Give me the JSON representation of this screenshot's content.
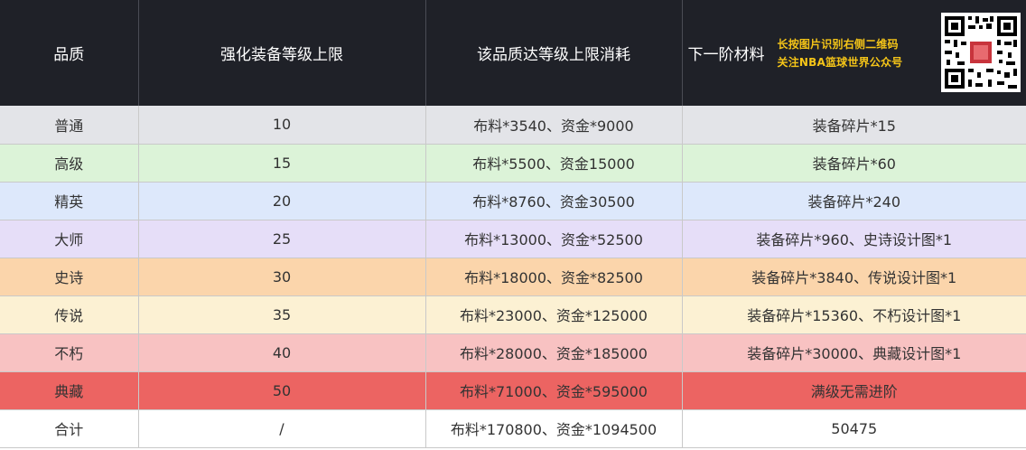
{
  "header": {
    "quality": "品质",
    "level_cap": "强化装备等级上限",
    "cost": "该品质达等级上限消耗",
    "next_material": "下一阶材料",
    "promo_line1": "长按图片识别右侧二维码",
    "promo_line2": "关注NBA篮球世界公众号",
    "qr_icon": "qr-code-icon"
  },
  "rows": [
    {
      "quality": "普通",
      "level": "10",
      "cost": "布料*3540、资金*9000",
      "next": "装备碎片*15",
      "color": "#e3e4e8"
    },
    {
      "quality": "高级",
      "level": "15",
      "cost": "布料*5500、资金15000",
      "next": "装备碎片*60",
      "color": "#dcf3d8"
    },
    {
      "quality": "精英",
      "level": "20",
      "cost": "布料*8760、资金30500",
      "next": "装备碎片*240",
      "color": "#dde8fb"
    },
    {
      "quality": "大师",
      "level": "25",
      "cost": "布料*13000、资金*52500",
      "next": "装备碎片*960、史诗设计图*1",
      "color": "#e6def8"
    },
    {
      "quality": "史诗",
      "level": "30",
      "cost": "布料*18000、资金*82500",
      "next": "装备碎片*3840、传说设计图*1",
      "color": "#fbd5ab"
    },
    {
      "quality": "传说",
      "level": "35",
      "cost": "布料*23000、资金*125000",
      "next": "装备碎片*15360、不朽设计图*1",
      "color": "#fcf1d3"
    },
    {
      "quality": "不朽",
      "level": "40",
      "cost": "布料*28000、资金*185000",
      "next": "装备碎片*30000、典藏设计图*1",
      "color": "#f8c2c2"
    },
    {
      "quality": "典藏",
      "level": "50",
      "cost": "布料*71000、资金*595000",
      "next": "满级无需进阶",
      "color": "#ec6462"
    },
    {
      "quality": "合计",
      "level": "/",
      "cost": "布料*170800、资金*1094500",
      "next": "50475",
      "color": "#ffffff"
    }
  ]
}
